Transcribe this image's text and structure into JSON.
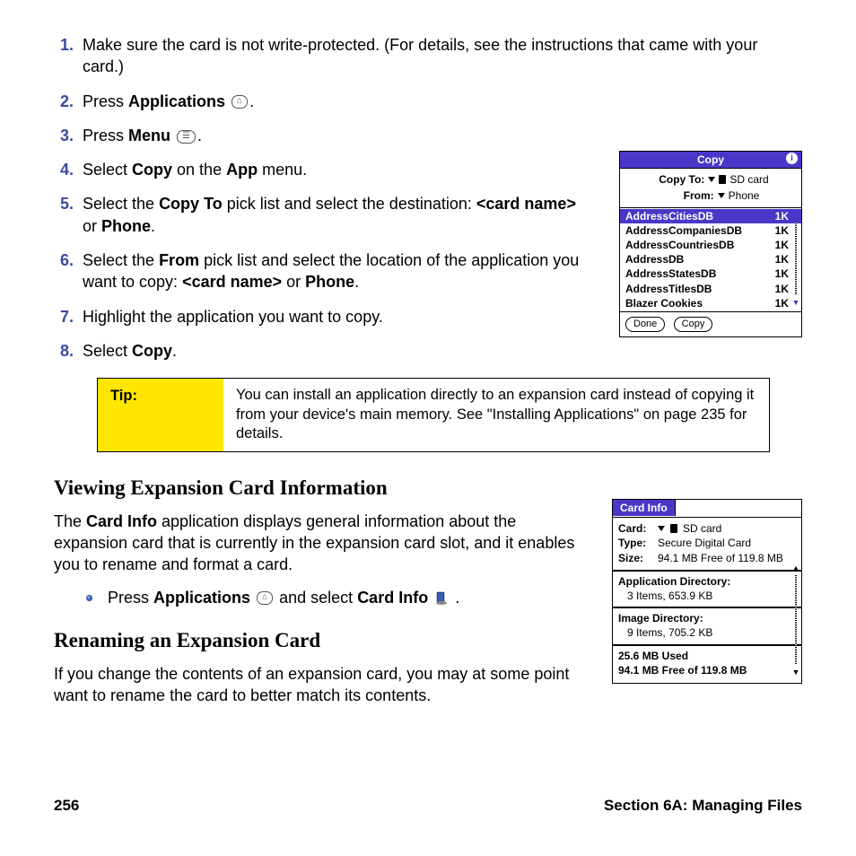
{
  "steps": [
    {
      "n": "1.",
      "t": "Make sure the card is not write-protected. (For details, see the instructions that came with your card.)"
    },
    {
      "n": "2.",
      "pre": "Press ",
      "bold": "Applications",
      "post": " ",
      "icon": "⌂",
      "tail": "."
    },
    {
      "n": "3.",
      "pre": "Press ",
      "bold": "Menu",
      "post": " ",
      "icon": "☰",
      "tail": "."
    },
    {
      "n": "4.",
      "pre": "Select ",
      "bold": "Copy",
      "mid": " on the ",
      "bold2": "App",
      "tail": " menu."
    },
    {
      "n": "5.",
      "pre": "Select the ",
      "bold": "Copy To",
      "mid": " pick list and select the destination: ",
      "bold2": "<card name>",
      "mid2": " or ",
      "bold3": "Phone",
      "tail": "."
    },
    {
      "n": "6.",
      "pre": "Select the ",
      "bold": "From",
      "mid": " pick list and select the location of the application you want to copy: ",
      "bold2": "<card name>",
      "mid2": " or ",
      "bold3": "Phone",
      "tail": "."
    },
    {
      "n": "7.",
      "t": "Highlight the application you want to copy."
    },
    {
      "n": "8.",
      "pre": "Select ",
      "bold": "Copy",
      "tail": "."
    }
  ],
  "tip": {
    "label": "Tip:",
    "body": "You can install an application directly to an expansion card instead of copying it from your device's main memory. See \"Installing Applications\" on page 235 for details."
  },
  "h2_view": "Viewing Expansion Card Information",
  "para_view_pre": "The ",
  "para_view_bold": "Card Info",
  "para_view_post": " application displays general information about the expansion card that is currently in the expansion card slot, and it enables you to rename and format a card.",
  "bullet_pre": "Press ",
  "bullet_b1": "Applications",
  "bullet_icon1": "⌂",
  "bullet_mid": " and select ",
  "bullet_b2": "Card Info",
  "bullet_tail": " .",
  "h2_rename": "Renaming an Expansion Card",
  "para_rename": "If you change the contents of an expansion card, you may at some point want to rename the card to better match its contents.",
  "footer_left": "256",
  "footer_right": "Section 6A: Managing Files",
  "copy_dialog": {
    "title": "Copy",
    "info_glyph": "i",
    "copy_to_label": "Copy To:",
    "copy_to_val": "SD card",
    "from_label": "From:",
    "from_val": "Phone",
    "items": [
      {
        "name": "AddressCitiesDB",
        "size": "1K",
        "sel": true
      },
      {
        "name": "AddressCompaniesDB",
        "size": "1K"
      },
      {
        "name": "AddressCountriesDB",
        "size": "1K"
      },
      {
        "name": "AddressDB",
        "size": "1K"
      },
      {
        "name": "AddressStatesDB",
        "size": "1K"
      },
      {
        "name": "AddressTitlesDB",
        "size": "1K"
      },
      {
        "name": "Blazer Cookies",
        "size": "1K"
      }
    ],
    "btn_done": "Done",
    "btn_copy": "Copy"
  },
  "cardinfo_panel": {
    "title": "Card Info",
    "rows": {
      "card_label": "Card:",
      "card_val": "SD card",
      "type_label": "Type:",
      "type_val": "Secure Digital Card",
      "size_label": "Size:",
      "size_val": "94.1 MB Free of 119.8 MB"
    },
    "appdir_title": "Application Directory:",
    "appdir_sub": "3 Items, 653.9 KB",
    "imgdir_title": "Image Directory:",
    "imgdir_sub": "9 Items, 705.2 KB",
    "usage1": "25.6 MB Used",
    "usage2": "94.1 MB Free of 119.8 MB"
  }
}
